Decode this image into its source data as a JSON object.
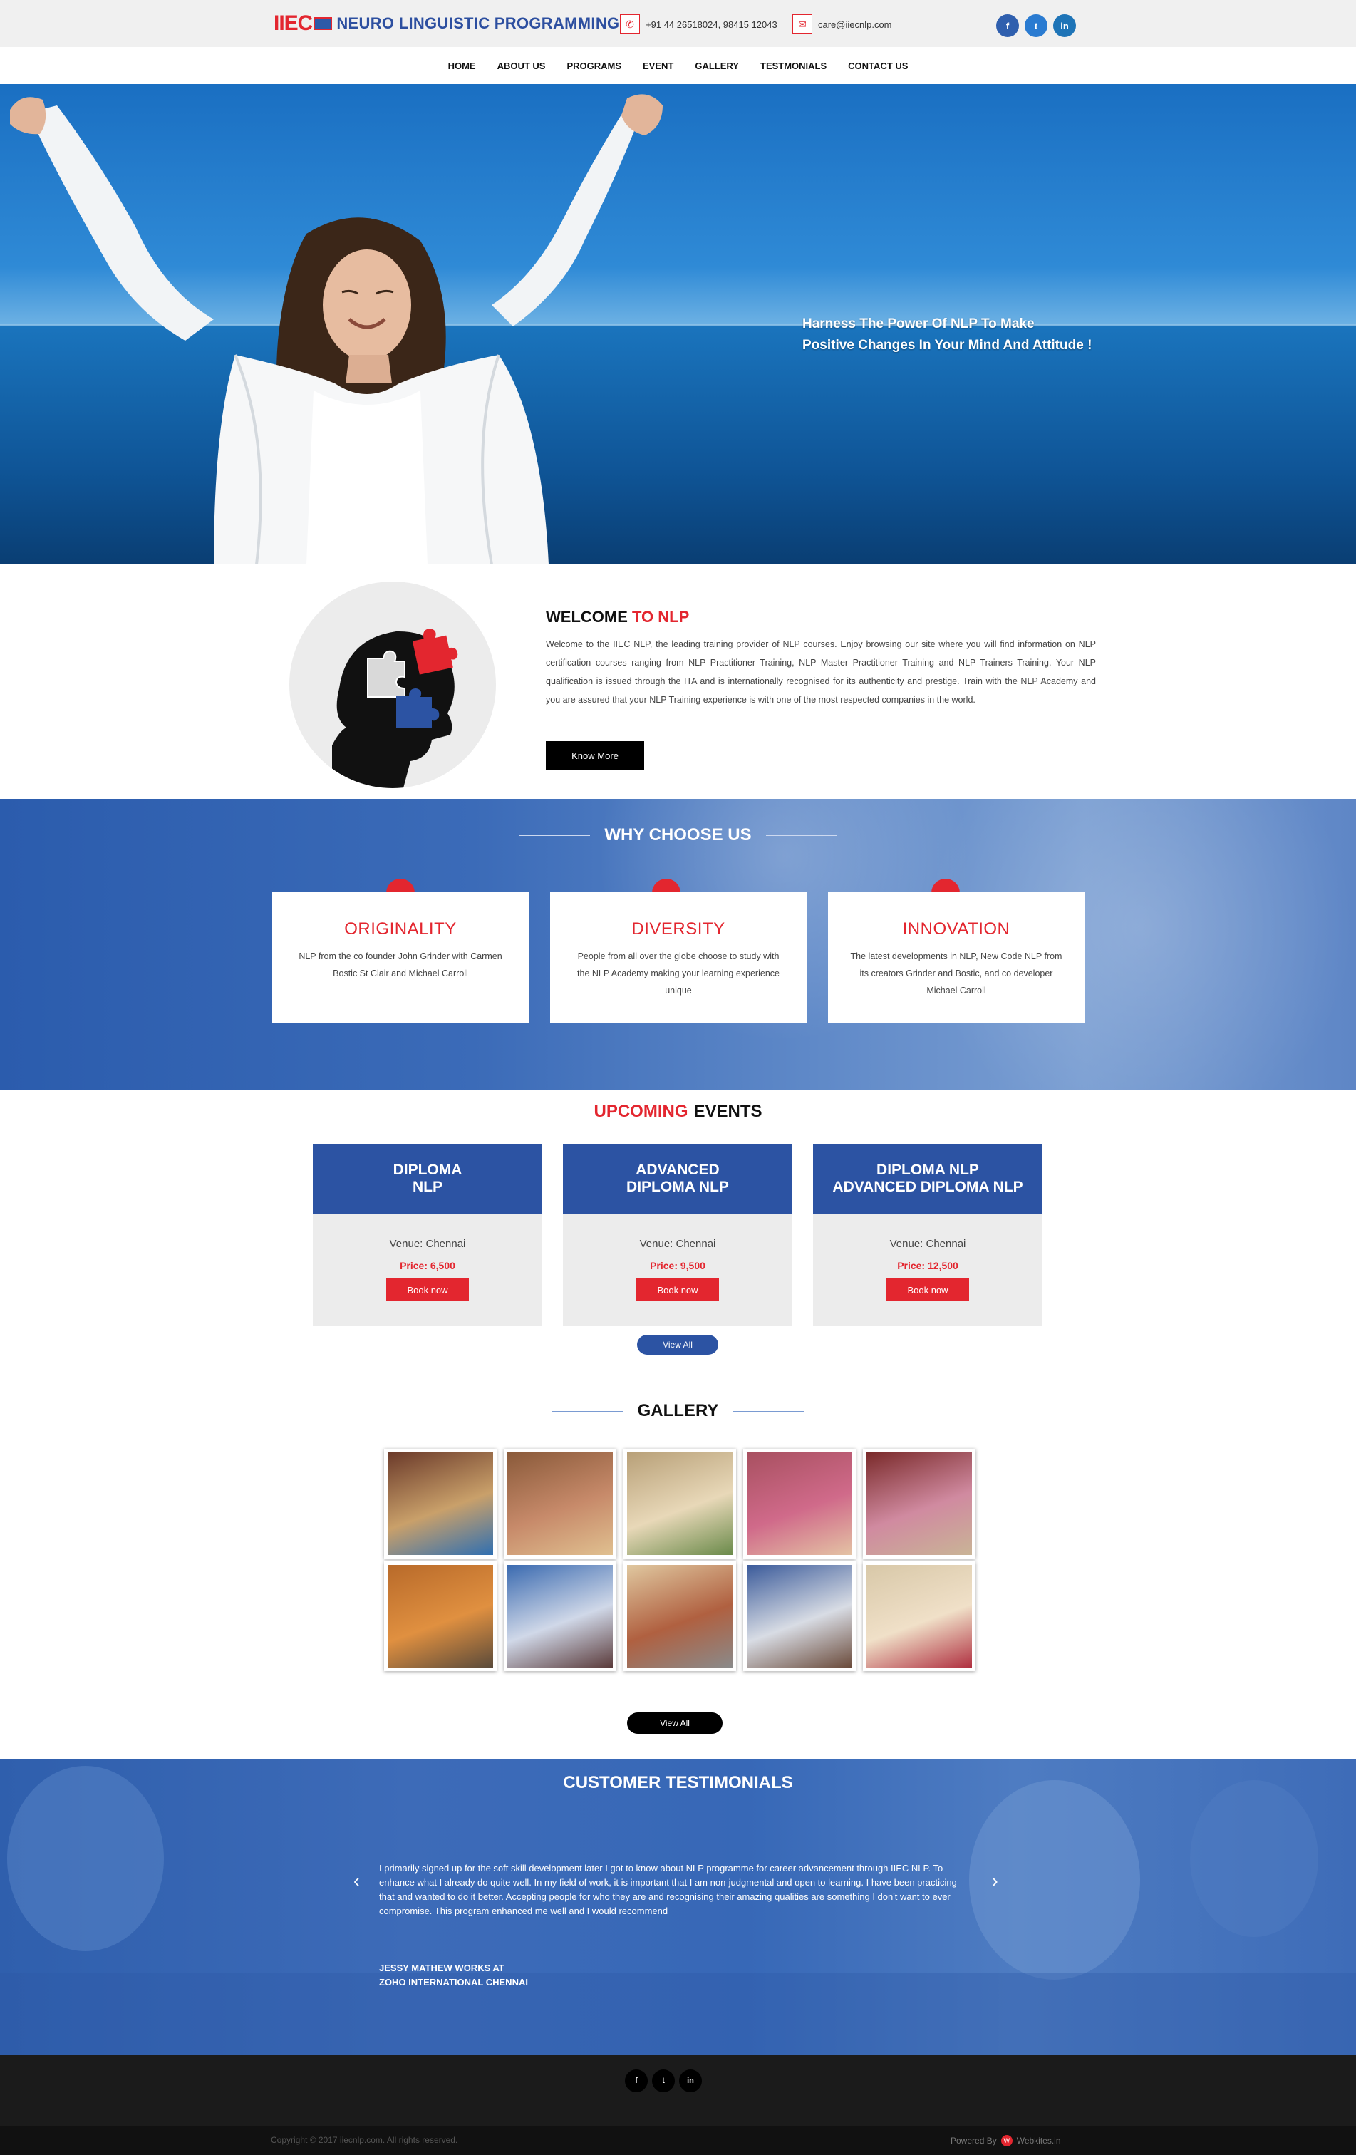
{
  "header": {
    "logo_mark": "IIEC",
    "logo_text": "NEURO LINGUISTIC PROGRAMMING",
    "phone": "+91 44 26518024, 98415 12043",
    "email": "care@iiecnlp.com",
    "phone_icon": "phone-icon",
    "email_icon": "mail-icon",
    "social": [
      {
        "name": "facebook",
        "glyph": "f"
      },
      {
        "name": "twitter",
        "glyph": "t"
      },
      {
        "name": "linkedin",
        "glyph": "in"
      }
    ]
  },
  "nav": {
    "items": [
      "HOME",
      "ABOUT US",
      "PROGRAMS",
      "EVENT",
      "GALLERY",
      "TESTMONIALS",
      "CONTACT US"
    ]
  },
  "hero": {
    "line1": "Harness The Power Of NLP To Make",
    "line2": "Positive Changes In Your Mind And Attitude !"
  },
  "welcome": {
    "title_black": "WELCOME",
    "title_red": "TO NLP",
    "body": "Welcome to the IIEC NLP, the leading training provider of NLP courses. Enjoy browsing our site where you will find information on NLP certification courses ranging from NLP Practitioner Training, NLP Master Practitioner Training and NLP Trainers Training. Your NLP qualification is issued through the ITA and is internationally recognised for its authenticity and prestige. Train with the NLP Academy and you are assured that your NLP Training experience is with one of the most respected companies in the world.",
    "button": "Know More"
  },
  "why": {
    "title": "WHY CHOOSE US",
    "cards": [
      {
        "title": "ORIGINALITY",
        "text": "NLP from the co founder John Grinder with Carmen Bostic St Clair and Michael Carroll"
      },
      {
        "title": "DIVERSITY",
        "text": "People from all over the globe choose to study with the NLP Academy making your learning experience unique"
      },
      {
        "title": "INNOVATION",
        "text": "The latest developments in NLP, New Code NLP from its creators Grinder and Bostic, and co developer Michael Carroll"
      }
    ]
  },
  "events": {
    "title_red": "UPCOMING",
    "title_black": "EVENTS",
    "cards": [
      {
        "line1": "DIPLOMA",
        "line2": "NLP",
        "venue": "Venue: Chennai",
        "price": "Price: 6,500",
        "button": "Book now"
      },
      {
        "line1": "ADVANCED",
        "line2": "DIPLOMA NLP",
        "venue": "Venue: Chennai",
        "price": "Price: 9,500",
        "button": "Book now"
      },
      {
        "line1": "DIPLOMA NLP",
        "line2": "ADVANCED DIPLOMA NLP",
        "venue": "Venue: Chennai",
        "price": "Price: 12,500",
        "button": "Book now"
      }
    ],
    "view_all": "View All"
  },
  "gallery": {
    "title": "GALLERY",
    "view_all": "View All",
    "photo_count_shown": 10
  },
  "testimonials": {
    "title": "CUSTOMER TESTIMONIALS",
    "quote": "I primarily signed up for the soft skill development later I got to know about NLP programme for career advancement through IIEC NLP. To enhance what I already do quite well. In my field of work, it is important that I am non-judgmental and open to learning. I have been practicing that and wanted to do it better. Accepting people for who they are and recognising their amazing qualities are something I don't want to ever compromise. This program enhanced me well and I would recommend",
    "author_line1": "JESSY MATHEW WORKS AT",
    "author_line2": "ZOHO INTERNATIONAL CHENNAI",
    "prev_glyph": "‹",
    "next_glyph": "›"
  },
  "footer": {
    "social": [
      "f",
      "t",
      "in"
    ],
    "copyright": "Copyright © 2017 iiecnlp.com. All rights reserved.",
    "powered_by": "Powered By",
    "powered_logo": "W",
    "powered_name": "Webkites.in"
  },
  "colors": {
    "brand_red": "#e3262f",
    "brand_blue": "#2c53a3",
    "footer_dark": "#1b1b1b"
  }
}
